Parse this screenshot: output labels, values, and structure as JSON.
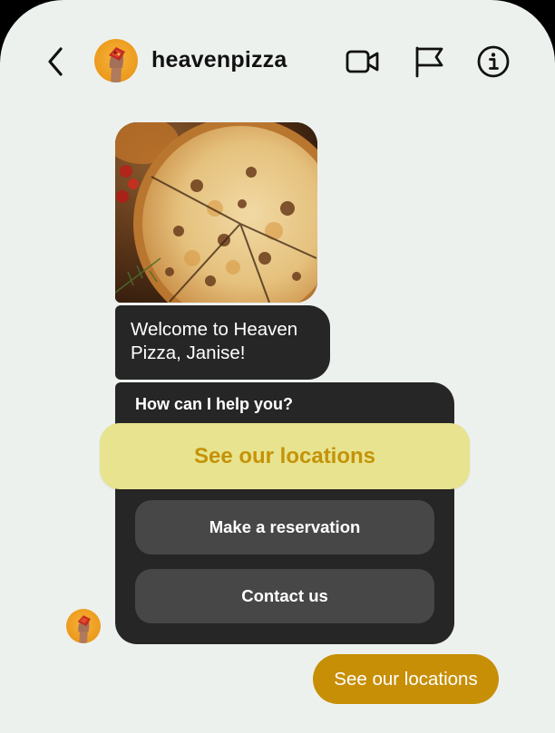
{
  "header": {
    "username": "heavenpizza"
  },
  "icons": {
    "back": "chevron-left-icon",
    "avatar": "pizza-hand-avatar",
    "video": "video-camera-icon",
    "flag": "flag-icon",
    "info": "info-icon"
  },
  "messages": {
    "welcome": "Welcome to Heaven Pizza, Janise!",
    "prompt": "How can I help you?",
    "sent": "See our locations"
  },
  "quick_replies": {
    "locations": "See our locations",
    "reservation": "Make a reservation",
    "contact": "Contact us"
  },
  "colors": {
    "background": "#edf1ee",
    "bubble_dark": "#262626",
    "button_dark": "#474747",
    "highlight_bg": "#e8e38f",
    "highlight_text": "#c49308",
    "sent_bubble": "#c78f06"
  }
}
